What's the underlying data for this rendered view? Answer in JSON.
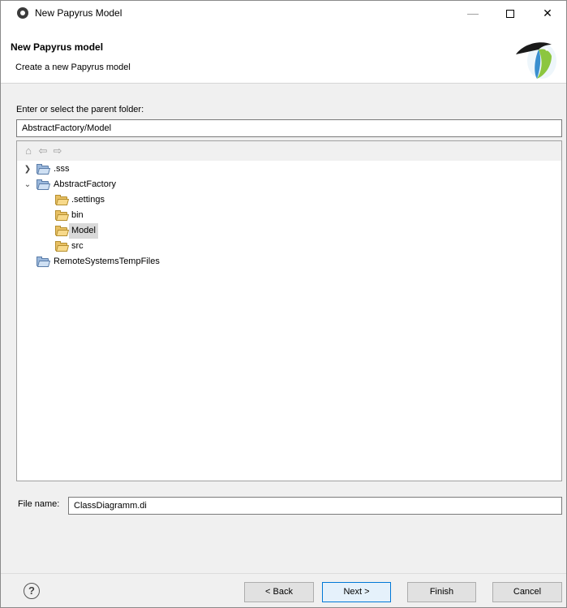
{
  "window": {
    "title": "New Papyrus Model"
  },
  "header": {
    "title": "New Papyrus model",
    "description": "Create a new Papyrus model"
  },
  "parent_folder": {
    "label": "Enter or select the parent folder:",
    "value": "AbstractFactory/Model"
  },
  "tree": {
    "toolbar": [
      "home-icon",
      "back-arrow-icon",
      "forward-arrow-icon"
    ],
    "items": [
      {
        "label": ".sss",
        "type": "project",
        "expanded": false
      },
      {
        "label": "AbstractFactory",
        "type": "project",
        "expanded": true
      },
      {
        "label": ".settings",
        "type": "folder"
      },
      {
        "label": "bin",
        "type": "folder"
      },
      {
        "label": "Model",
        "type": "folder",
        "selected": true
      },
      {
        "label": "src",
        "type": "folder"
      },
      {
        "label": "RemoteSystemsTempFiles",
        "type": "project"
      }
    ]
  },
  "file_name": {
    "label": "File name:",
    "value": "ClassDiagramm.di"
  },
  "buttons": {
    "back": "< Back",
    "next": "Next >",
    "finish": "Finish",
    "cancel": "Cancel"
  },
  "colors": {
    "selection": "#d9d9d9",
    "default_button_border": "#0078d7",
    "folder": "#e8c064"
  }
}
